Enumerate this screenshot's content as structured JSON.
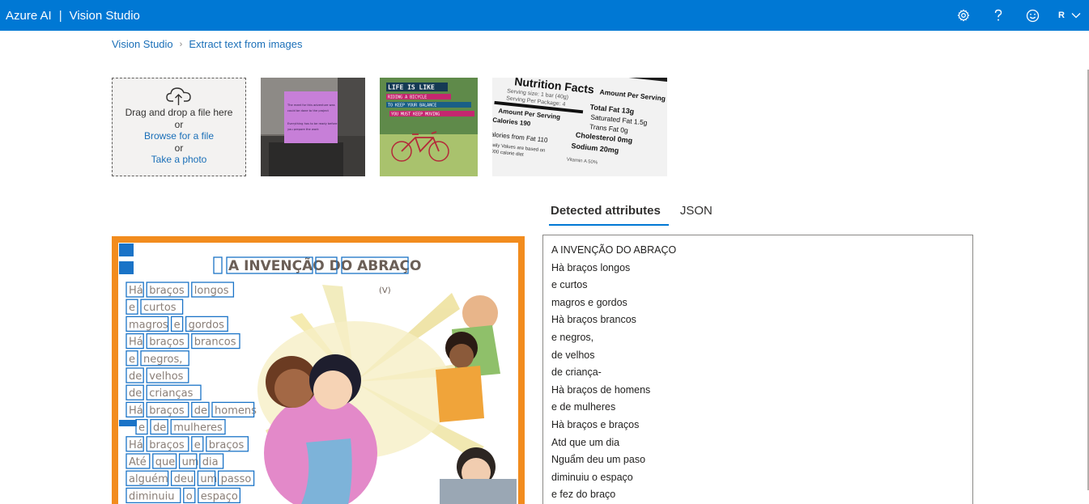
{
  "header": {
    "brand": "Azure AI",
    "separator": "|",
    "product": "Vision Studio",
    "user_initial": "R",
    "icons": [
      "gear-icon",
      "help-icon",
      "feedback-smiley-icon",
      "chevron-down-icon"
    ]
  },
  "breadcrumb": {
    "home": "Vision Studio",
    "current": "Extract text from images"
  },
  "upload": {
    "drag_text": "Drag and drop a file here",
    "or1": "or",
    "browse": "Browse for a file",
    "or2": "or",
    "photo": "Take a photo"
  },
  "samples": [
    {
      "name": "sticky-note",
      "lines": [
        "The meet for this adventure was",
        "could be done to the project",
        "Everything has to be ready before",
        "you prepare the work"
      ]
    },
    {
      "name": "bicycle",
      "lines": [
        "LIFE IS LIKE",
        "RIDING A BICYCLE",
        "TO KEEP YOUR BALANCE",
        "YOU MUST KEEP MOVING"
      ]
    },
    {
      "name": "nutrition",
      "lines": [
        "Nutrition Facts",
        "Serving size: 1 bar (40g)",
        "Serving Per Package: 4",
        "Amount Per Serving",
        "Calories 190",
        "Calories from Fat 110",
        "Amount Per Serving",
        "Total Fat 13g",
        "Saturated Fat 1.5g",
        "Trans Fat 0g",
        "Cholesterol 0mg",
        "Sodium 20mg",
        "% Daily Values are based on",
        "a 2,000 calorie diet",
        "Vitamin A 50%"
      ]
    }
  ],
  "tabs": {
    "detected": "Detected attributes",
    "json": "JSON"
  },
  "preview": {
    "title": "A INVENÇÃO DO ABRAÇO",
    "page_mark": "(V)",
    "lines": [
      [
        "Há",
        "braços",
        "longos"
      ],
      [
        "e",
        "curtos"
      ],
      [
        "magros",
        "e",
        "gordos"
      ],
      [
        "Há",
        "braços",
        "brancos"
      ],
      [
        "e",
        "negros,"
      ],
      [
        "de",
        "velhos"
      ],
      [
        "de",
        "crianças"
      ],
      [
        "Há",
        "braços",
        "de",
        "homens"
      ],
      [
        "e",
        "de",
        "mulheres"
      ],
      [
        "Há",
        "braços",
        "e",
        "braços"
      ],
      [
        "Até",
        "que",
        "um",
        "dia"
      ],
      [
        "alguém",
        "deu",
        "um",
        "passo"
      ],
      [
        "diminuiu",
        "o",
        "espaço"
      ]
    ]
  },
  "results": [
    "A INVENÇÃO DO ABRAÇO",
    "Hà braços longos",
    "e curtos",
    "magros e gordos",
    "Hà braços brancos",
    "e negros,",
    "de velhos",
    "de criança-",
    "Hà braços de homens",
    "e de mulheres",
    "Hà braços e braços",
    "Atd que um dia",
    "Nguẩm deu um paso",
    "diminuiu o espaço",
    "e fez do braço"
  ]
}
